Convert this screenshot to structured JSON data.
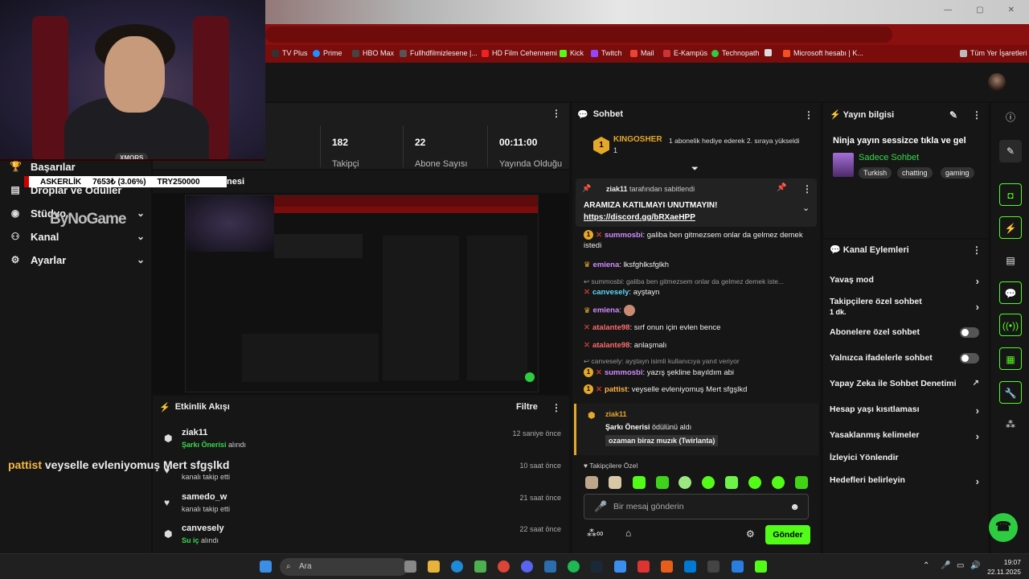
{
  "bookmarks": [
    "TV Plus",
    "Prime",
    "HBO Max",
    "Fullhdfilmizlesene |...",
    "HD Film Cehennemi",
    "Kick",
    "Twitch",
    "Mail",
    "E-Kampüs",
    "Technopath",
    "Microsoft hesabı | K...",
    "Tüm Yer İşaretleri"
  ],
  "webcam": {
    "tag": "XMORS"
  },
  "ticker": {
    "name": "ASKERLİK",
    "value": "7653₺ (3.06%)",
    "goal": "TRY250000"
  },
  "overlay_brand": {
    "by": "ByNo",
    "game": "Game"
  },
  "overlay_msg": {
    "user": "pattist",
    "text": "veyselle evleniyomuş Mert sfgşlkd"
  },
  "nav": [
    {
      "label": "Başarılar",
      "icon": "trophy-icon"
    },
    {
      "label": "Droplar ve Ödüller",
      "icon": "gift-icon"
    },
    {
      "label": "Stüdyo",
      "icon": "studio-icon"
    },
    {
      "label": "Kanal",
      "icon": "user-icon"
    },
    {
      "label": "Ayarlar",
      "icon": "gear-icon"
    }
  ],
  "stats": [
    {
      "value": "182",
      "label": "Takipçi"
    },
    {
      "value": "22",
      "label": "Abone Sayısı"
    },
    {
      "value": "00:11:00",
      "label": "Yayında Olduğu"
    }
  ],
  "preview": {
    "title_suffix": "nesi"
  },
  "activity": {
    "title": "Etkinlik Akışı",
    "filter": "Filtre",
    "rows": [
      {
        "name": "ziak11",
        "sub_hl": "Şarkı Önerisi",
        "sub": " alındı",
        "time": "12 saniye önce",
        "icon": "reward-icon"
      },
      {
        "name": "",
        "sub_hl": "",
        "sub": "kanalı takip etti",
        "time": "10 saat önce",
        "icon": "heart-icon"
      },
      {
        "name": "samedo_w",
        "sub_hl": "",
        "sub": "kanalı takip etti",
        "time": "21 saat önce",
        "icon": "heart-icon"
      },
      {
        "name": "canvesely",
        "sub_hl": "Su iç",
        "sub": " alındı",
        "time": "22 saat önce",
        "icon": "reward-icon"
      }
    ]
  },
  "chat": {
    "title": "Sohbet",
    "hype": {
      "user": "KINGOSHER",
      "count": "1",
      "text": "1 abonelik hediye ederek 2. sıraya yükseldi"
    },
    "pinned": {
      "by_user": "ziak11",
      "by_text": " tarafından sabitlendi",
      "line1": "ARAMIZA KATILMAYI UNUTMAYIN!",
      "line2": "https://discord.gg/bRXaeHPP"
    },
    "messages": [
      {
        "user": "summosbi",
        "text": "galiba ben gitmezsem onlar da gelmez demek istedi"
      },
      {
        "user": "emiena",
        "text": "lksfghlksfglkh"
      },
      {
        "reply": "summosbi: galiba ben gitmezsem onlar da gelmez demek iste..."
      },
      {
        "user": "canvesely",
        "text": "ayştayn"
      },
      {
        "user": "emiena",
        "text": ""
      },
      {
        "user": "atalante98",
        "text": "sırf onun için evlen bence"
      },
      {
        "user": "atalante98",
        "text": "anlaşmalı"
      },
      {
        "reply": "canvesely: ayştayn isimli kullanıcıya yanıt veriyor"
      },
      {
        "user": "summosbi",
        "text": "yazış şekline bayıldım abi"
      },
      {
        "user": "pattist",
        "text": "veyselle evleniyomuş Mert sfgşlkd"
      }
    ],
    "reward": {
      "user": "ziak11",
      "reward": "Şarkı Önerisi",
      "suffix": " ödülünü aldı",
      "value": "ozaman biraz muzık (Twirlanta)"
    },
    "emotes_label": "Takipçilere Özel",
    "input_placeholder": "Bir mesaj gönderin",
    "send": "Gönder"
  },
  "stream_info": {
    "header": "Yayın bilgisi",
    "title": "Ninja yayın sessizce tıkla ve gel",
    "category": "Sadece Sohbet",
    "tags": [
      "Turkish",
      "chatting",
      "gaming"
    ]
  },
  "channel_actions": {
    "header": "Kanal Eylemleri",
    "items": [
      {
        "label": "Yavaş mod",
        "control": "chevron"
      },
      {
        "label": "Takipçilere özel sohbet",
        "sub": "1 dk.",
        "control": "chevron"
      },
      {
        "label": "Abonelere özel sohbet",
        "control": "toggle"
      },
      {
        "label": "Yalnızca ifadelerle sohbet",
        "control": "toggle"
      },
      {
        "label": "Yapay Zeka ile Sohbet Denetimi",
        "control": "external"
      },
      {
        "label": "Hesap yaşı kısıtlaması",
        "control": "chevron"
      },
      {
        "label": "Yasaklanmış kelimeler",
        "control": "chevron"
      },
      {
        "label": "İzleyici Yönlendir",
        "control": "none"
      },
      {
        "label": "Hedefleri belirleyin",
        "control": "chevron"
      }
    ]
  },
  "taskbar": {
    "search": "Ara",
    "time": "19:07",
    "date": "22.11.2025"
  },
  "colors": {
    "accent": "#53fc18",
    "brand_red": "#7a0c0c",
    "gold": "#e5a82a"
  }
}
